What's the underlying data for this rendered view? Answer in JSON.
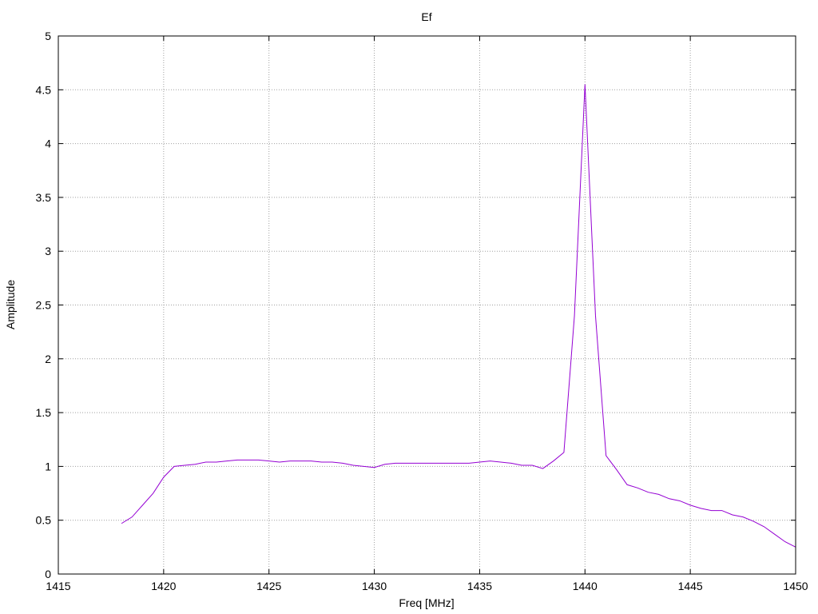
{
  "chart_data": {
    "type": "line",
    "title": "Ef",
    "xlabel": "Freq [MHz]",
    "ylabel": "Amplitude",
    "xlim": [
      1415,
      1450
    ],
    "ylim": [
      0,
      5
    ],
    "x_ticks": [
      1415,
      1420,
      1425,
      1430,
      1435,
      1440,
      1445,
      1450
    ],
    "y_ticks": [
      0,
      0.5,
      1,
      1.5,
      2,
      2.5,
      3,
      3.5,
      4,
      4.5,
      5
    ],
    "grid": true,
    "grid_style": "dotted",
    "legend": "none",
    "series": [
      {
        "color": "#9400d3",
        "x": [
          1418.0,
          1418.5,
          1419.0,
          1419.5,
          1420.0,
          1420.5,
          1421.0,
          1421.5,
          1422.0,
          1422.5,
          1423.0,
          1423.5,
          1424.0,
          1424.5,
          1425.0,
          1425.5,
          1426.0,
          1426.5,
          1427.0,
          1427.5,
          1428.0,
          1428.5,
          1429.0,
          1429.5,
          1430.0,
          1430.5,
          1431.0,
          1431.5,
          1432.0,
          1433.0,
          1434.0,
          1434.5,
          1435.0,
          1435.5,
          1436.0,
          1436.5,
          1437.0,
          1437.5,
          1438.0,
          1438.5,
          1439.0,
          1439.5,
          1440.0,
          1440.5,
          1441.0,
          1441.5,
          1442.0,
          1442.5,
          1443.0,
          1443.5,
          1444.0,
          1444.5,
          1445.0,
          1445.5,
          1446.0,
          1446.5,
          1447.0,
          1447.5,
          1448.0,
          1448.5,
          1449.0,
          1449.5,
          1450.0
        ],
        "y": [
          0.47,
          0.53,
          0.64,
          0.75,
          0.9,
          1.0,
          1.01,
          1.02,
          1.04,
          1.04,
          1.05,
          1.06,
          1.06,
          1.06,
          1.05,
          1.04,
          1.05,
          1.05,
          1.05,
          1.04,
          1.04,
          1.03,
          1.01,
          1.0,
          0.99,
          1.02,
          1.03,
          1.03,
          1.03,
          1.03,
          1.03,
          1.03,
          1.04,
          1.05,
          1.04,
          1.03,
          1.01,
          1.01,
          0.98,
          1.05,
          1.13,
          2.4,
          4.55,
          2.4,
          1.1,
          0.97,
          0.83,
          0.8,
          0.76,
          0.74,
          0.7,
          0.68,
          0.64,
          0.61,
          0.59,
          0.59,
          0.55,
          0.53,
          0.49,
          0.44,
          0.37,
          0.3,
          0.25
        ]
      }
    ]
  }
}
